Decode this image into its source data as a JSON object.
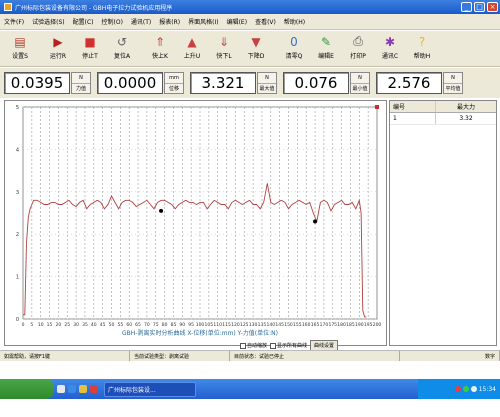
{
  "window": {
    "title": "广州标际包装设备有限公司 - GBH电子拉力试验机应用程序"
  },
  "menu": [
    "文件(F)",
    "试验选择(S)",
    "配置(C)",
    "控制(O)",
    "通讯(T)",
    "报表(R)",
    "界面风格(I)",
    "编辑(E)",
    "查看(V)",
    "帮助(H)"
  ],
  "toolbar": [
    {
      "label": "设置S",
      "icon": "settings-icon",
      "color": "#b23a2a"
    },
    {
      "label": "运行R",
      "icon": "run-icon",
      "color": "#b82020"
    },
    {
      "label": "停止T",
      "icon": "stop-icon",
      "color": "#d03030"
    },
    {
      "label": "复位A",
      "icon": "reset-icon",
      "color": "#606060"
    },
    {
      "label": "快上K",
      "icon": "fast-up-icon",
      "color": "#c84040"
    },
    {
      "label": "上升U",
      "icon": "up-icon",
      "color": "#c84040"
    },
    {
      "label": "快下L",
      "icon": "fast-down-icon",
      "color": "#c84040"
    },
    {
      "label": "下降D",
      "icon": "down-icon",
      "color": "#c84040"
    },
    {
      "label": "清零Q",
      "icon": "zero-icon",
      "color": "#3a70c8"
    },
    {
      "label": "编辑E",
      "icon": "edit-icon",
      "color": "#2a9a3a"
    },
    {
      "label": "打印P",
      "icon": "print-icon",
      "color": "#505050"
    },
    {
      "label": "通讯C",
      "icon": "communication-icon",
      "color": "#8a3ab0"
    },
    {
      "label": "帮助H",
      "icon": "help-icon",
      "color": "#e8b820"
    }
  ],
  "readouts": [
    {
      "value": "0.0395",
      "unit": "N",
      "name": "力值"
    },
    {
      "value": "0.0000",
      "unit": "mm",
      "name": "位移"
    },
    {
      "value": "3.321",
      "unit": "N",
      "name": "最大值"
    },
    {
      "value": "0.076",
      "unit": "N",
      "name": "最小值"
    },
    {
      "value": "2.576",
      "unit": "N",
      "name": "平均值"
    }
  ],
  "results": {
    "headers": [
      "编号",
      "最大力"
    ],
    "rows": [
      [
        "1",
        "3.32"
      ]
    ]
  },
  "chart_controls": {
    "auto_scale_label": "自动缩放",
    "show_all_label": "显示所有曲线",
    "curve_settings_label": "曲线设置"
  },
  "statusbar": [
    "如需帮助，请按F1键",
    "当前试验类型：剥离试验",
    "目前状态：试验已停止",
    "数字"
  ],
  "taskbar": {
    "task_label": "广州标际包装设...",
    "clock": "15:34"
  },
  "chart_data": {
    "type": "line",
    "title": "",
    "xlabel": "GBH-剥离实时分析曲线 X-位移(单位:mm) Y-力值(单位:N)",
    "ylabel": "",
    "xlim": [
      0,
      200
    ],
    "ylim": [
      0,
      5
    ],
    "xticks": [
      0,
      5,
      10,
      15,
      20,
      25,
      30,
      35,
      40,
      45,
      50,
      55,
      60,
      65,
      70,
      75,
      80,
      85,
      90,
      95,
      100,
      105,
      110,
      115,
      120,
      125,
      130,
      135,
      140,
      145,
      150,
      155,
      160,
      165,
      170,
      175,
      180,
      185,
      190,
      195,
      200
    ],
    "yticks": [
      0,
      1,
      2,
      3,
      4,
      5
    ],
    "grid": true,
    "series": [
      {
        "color": "#b04040",
        "x": [
          0,
          1,
          2,
          3,
          4,
          5,
          6,
          8,
          10,
          12,
          14,
          16,
          18,
          20,
          22,
          24,
          26,
          28,
          30,
          32,
          34,
          36,
          38,
          40,
          42,
          44,
          46,
          48,
          50,
          52,
          54,
          56,
          58,
          60,
          62,
          64,
          66,
          68,
          70,
          72,
          74,
          76,
          78,
          80,
          82,
          84,
          86,
          88,
          90,
          92,
          94,
          96,
          98,
          100,
          102,
          104,
          106,
          108,
          110,
          112,
          114,
          116,
          118,
          120,
          122,
          124,
          126,
          128,
          130,
          132,
          134,
          136,
          138,
          140,
          142,
          144,
          146,
          148,
          150,
          152,
          154,
          156,
          158,
          160,
          162,
          164,
          166,
          168,
          170,
          172,
          174,
          176,
          178,
          180,
          182,
          184,
          186,
          188,
          190,
          191,
          192,
          193,
          194
        ],
        "y": [
          0.1,
          0.1,
          1.8,
          2.4,
          2.6,
          2.7,
          2.8,
          2.8,
          2.75,
          2.7,
          2.7,
          2.75,
          2.75,
          2.7,
          2.7,
          2.75,
          2.8,
          2.7,
          2.65,
          2.75,
          2.8,
          2.6,
          2.7,
          2.75,
          2.8,
          2.75,
          2.6,
          2.7,
          2.9,
          2.75,
          2.6,
          2.75,
          2.8,
          2.8,
          2.75,
          2.65,
          2.7,
          2.75,
          2.8,
          2.7,
          2.6,
          2.75,
          2.8,
          2.8,
          2.75,
          2.7,
          2.6,
          2.7,
          2.75,
          2.8,
          2.75,
          2.75,
          2.7,
          2.75,
          2.75,
          2.6,
          2.7,
          2.8,
          2.75,
          2.7,
          2.7,
          2.6,
          2.75,
          2.8,
          2.75,
          2.7,
          2.75,
          2.8,
          2.7,
          2.7,
          2.6,
          2.75,
          3.2,
          2.75,
          2.7,
          2.75,
          2.8,
          2.75,
          2.6,
          2.7,
          2.75,
          2.8,
          2.75,
          2.7,
          2.75,
          2.5,
          2.3,
          2.75,
          2.8,
          2.75,
          2.55,
          2.7,
          2.75,
          2.8,
          2.7,
          2.7,
          2.75,
          2.6,
          2.8,
          2.5,
          0.2,
          0.05,
          0.05
        ]
      }
    ],
    "markers": [
      {
        "x": 78,
        "y": 2.55
      },
      {
        "x": 165,
        "y": 2.3
      },
      {
        "x": 200,
        "y": 5
      }
    ]
  }
}
